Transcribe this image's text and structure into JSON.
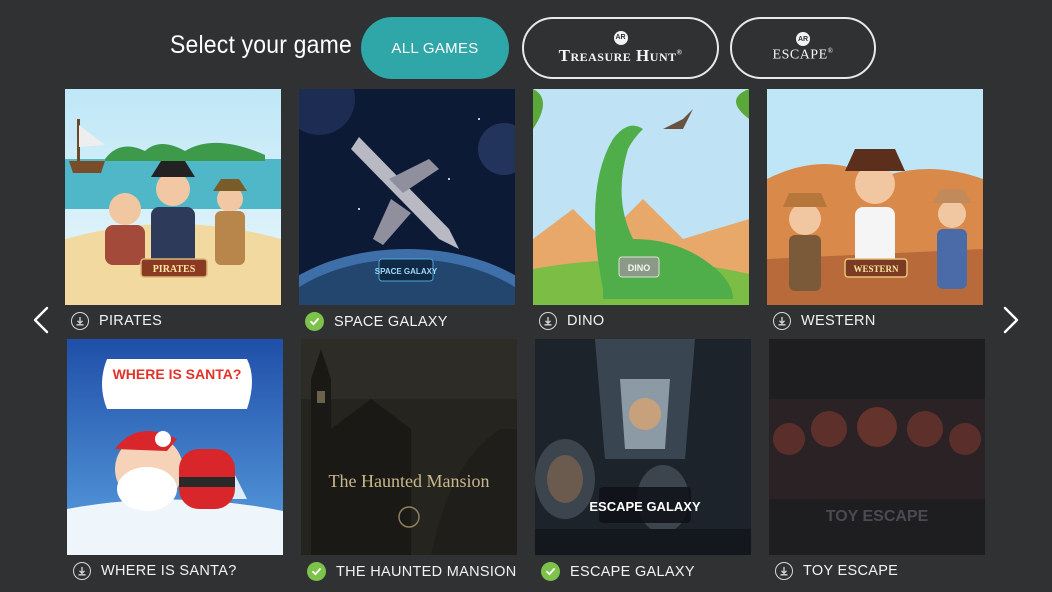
{
  "header": {
    "title": "Select your game"
  },
  "filters": {
    "all_label": "ALL GAMES",
    "treasure_hunt": {
      "badge": "AR",
      "label": "Treasure Hunt"
    },
    "escape": {
      "badge": "AR",
      "label": "ESCAPE"
    }
  },
  "games": [
    {
      "title": "PIRATES",
      "status": "download",
      "logo": "PIRATES"
    },
    {
      "title": "SPACE GALAXY",
      "status": "installed",
      "logo": "SPACE GALAXY"
    },
    {
      "title": "DINO",
      "status": "download",
      "logo": "DINO"
    },
    {
      "title": "WESTERN",
      "status": "download",
      "logo": "WESTERN"
    },
    {
      "title": "WHERE IS SANTA?",
      "status": "download",
      "logo": "WHERE IS SANTA?"
    },
    {
      "title": "THE HAUNTED MANSION",
      "status": "installed",
      "logo": "The Haunted Mansion"
    },
    {
      "title": "ESCAPE GALAXY",
      "status": "installed",
      "logo": "ESCAPE GALAXY"
    },
    {
      "title": "TOY ESCAPE",
      "status": "download",
      "logo": "TOY ESCAPE"
    }
  ],
  "colors": {
    "background": "#2f3133",
    "accent": "#2fa6a8",
    "installed": "#7dc24b"
  },
  "icons": {
    "download": "download-circle-icon",
    "installed": "check-circle-icon",
    "prev": "chevron-left-icon",
    "next": "chevron-right-icon"
  }
}
